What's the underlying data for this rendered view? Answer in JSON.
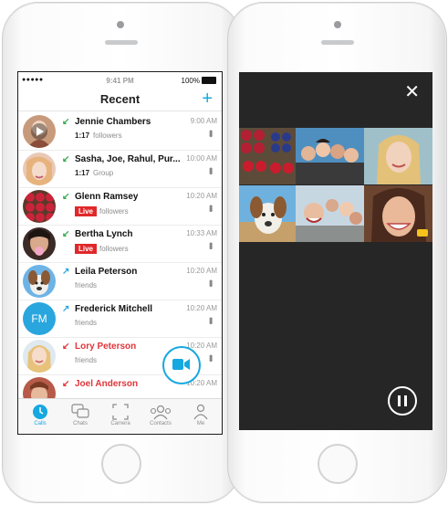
{
  "status": {
    "signal": "●●●●● ",
    "time": "9:41 PM",
    "battery": "100%"
  },
  "header": {
    "title": "Recent",
    "add_label": "+"
  },
  "calls": [
    {
      "name": "Jennie Chambers",
      "time": "9:00 AM",
      "direction": "incoming",
      "count": "1:17",
      "detail": "followers",
      "live": ""
    },
    {
      "name": "Sasha, Joe, Rahul, Pur...",
      "time": "10:00 AM",
      "direction": "incoming",
      "count": "1:17",
      "detail": "Group",
      "live": ""
    },
    {
      "name": "Glenn Ramsey",
      "time": "10:20 AM",
      "direction": "incoming",
      "count": "",
      "detail": "followers",
      "live": "Live"
    },
    {
      "name": "Bertha Lynch",
      "time": "10:33 AM",
      "direction": "incoming",
      "count": "",
      "detail": "followers",
      "live": "Live"
    },
    {
      "name": "Leila Peterson",
      "time": "10:20 AM",
      "direction": "outgoing",
      "count": "",
      "detail": "friends",
      "live": ""
    },
    {
      "name": "Frederick Mitchell",
      "time": "10:20 AM",
      "direction": "outgoing",
      "count": "",
      "detail": "friends",
      "live": "",
      "initials": "FM"
    },
    {
      "name": "Lory Peterson",
      "time": "10:20 AM",
      "direction": "missed",
      "count": "",
      "detail": "friends",
      "live": ""
    },
    {
      "name": "Joel Anderson",
      "time": "10:20 AM",
      "direction": "missed",
      "count": "",
      "detail": "",
      "live": ""
    }
  ],
  "tabs": [
    {
      "label": "Calls",
      "icon": "clock-icon",
      "active": true
    },
    {
      "label": "Chats",
      "icon": "chat-bubbles-icon",
      "active": false
    },
    {
      "label": "Camera",
      "icon": "camera-frame-icon",
      "active": false
    },
    {
      "label": "Contacts",
      "icon": "contacts-icon",
      "active": false
    },
    {
      "label": "Me",
      "icon": "person-icon",
      "active": false
    }
  ],
  "colors": {
    "accent": "#16a8e0",
    "live": "#e0282a",
    "incoming": "#37a84f",
    "missed": "#e0353a",
    "video_bg": "#262626"
  },
  "video": {
    "close_icon": "close-icon",
    "pause_icon": "pause-icon"
  }
}
